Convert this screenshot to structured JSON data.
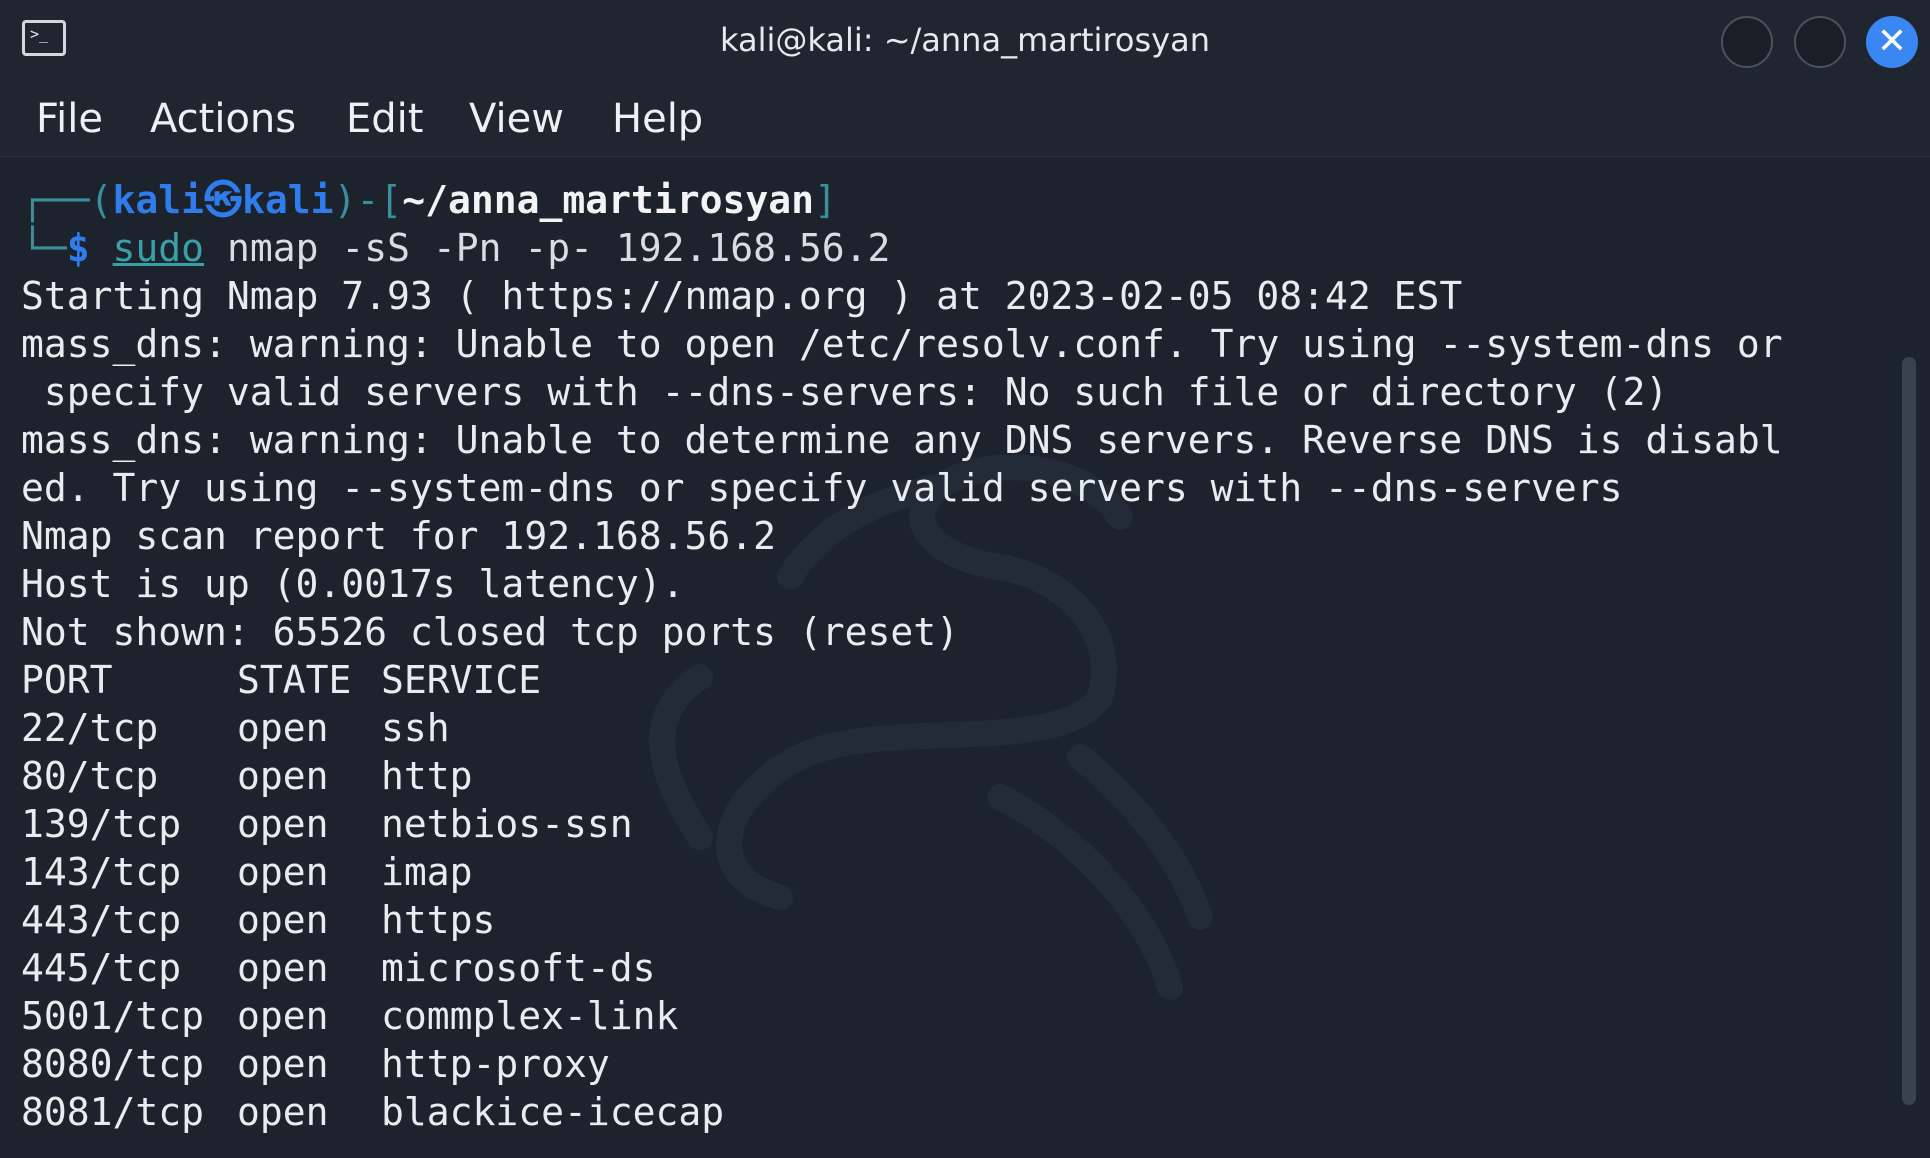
{
  "window": {
    "title": "kali@kali: ~/anna_martirosyan",
    "icon": "terminal-icon",
    "controls": [
      "minimize-icon",
      "maximize-icon",
      "close-icon"
    ],
    "close_glyph": "✕",
    "accent_color": "#3a86f2"
  },
  "menu": {
    "items": [
      "File",
      "Actions",
      "Edit",
      "View",
      "Help"
    ]
  },
  "prompt": {
    "corner_top": "┌──(",
    "user": "kali",
    "at_symbol": "㉿",
    "host": "kali",
    "mid": ")-[",
    "cwd": "~/anna_martirosyan",
    "end_bracket": "]",
    "corner_bottom": "└─",
    "dollar": "$",
    "cmd_sudo": "sudo",
    "cmd_rest": " nmap -sS -Pn -p- 192.168.56.2"
  },
  "output": {
    "lines": [
      "Starting Nmap 7.93 ( https://nmap.org ) at 2023-02-05 08:42 EST",
      "mass_dns: warning: Unable to open /etc/resolv.conf. Try using --system-dns or",
      " specify valid servers with --dns-servers: No such file or directory (2)",
      "mass_dns: warning: Unable to determine any DNS servers. Reverse DNS is disabl",
      "ed. Try using --system-dns or specify valid servers with --dns-servers",
      "Nmap scan report for 192.168.56.2",
      "Host is up (0.0017s latency).",
      "Not shown: 65526 closed tcp ports (reset)"
    ],
    "table_header": {
      "port": "PORT",
      "state": "STATE",
      "service": "SERVICE"
    },
    "ports": [
      {
        "port": "22/tcp",
        "state": "open",
        "service": "ssh"
      },
      {
        "port": "80/tcp",
        "state": "open",
        "service": "http"
      },
      {
        "port": "139/tcp",
        "state": "open",
        "service": "netbios-ssn"
      },
      {
        "port": "143/tcp",
        "state": "open",
        "service": "imap"
      },
      {
        "port": "443/tcp",
        "state": "open",
        "service": "https"
      },
      {
        "port": "445/tcp",
        "state": "open",
        "service": "microsoft-ds"
      },
      {
        "port": "5001/tcp",
        "state": "open",
        "service": "commplex-link"
      },
      {
        "port": "8080/tcp",
        "state": "open",
        "service": "http-proxy"
      },
      {
        "port": "8081/tcp",
        "state": "open",
        "service": "blackice-icecap"
      }
    ]
  },
  "colors": {
    "background": "#1c232d",
    "prompt_blue": "#2f7dec",
    "prompt_teal": "#3c8f9a",
    "text": "#e9ecef"
  }
}
